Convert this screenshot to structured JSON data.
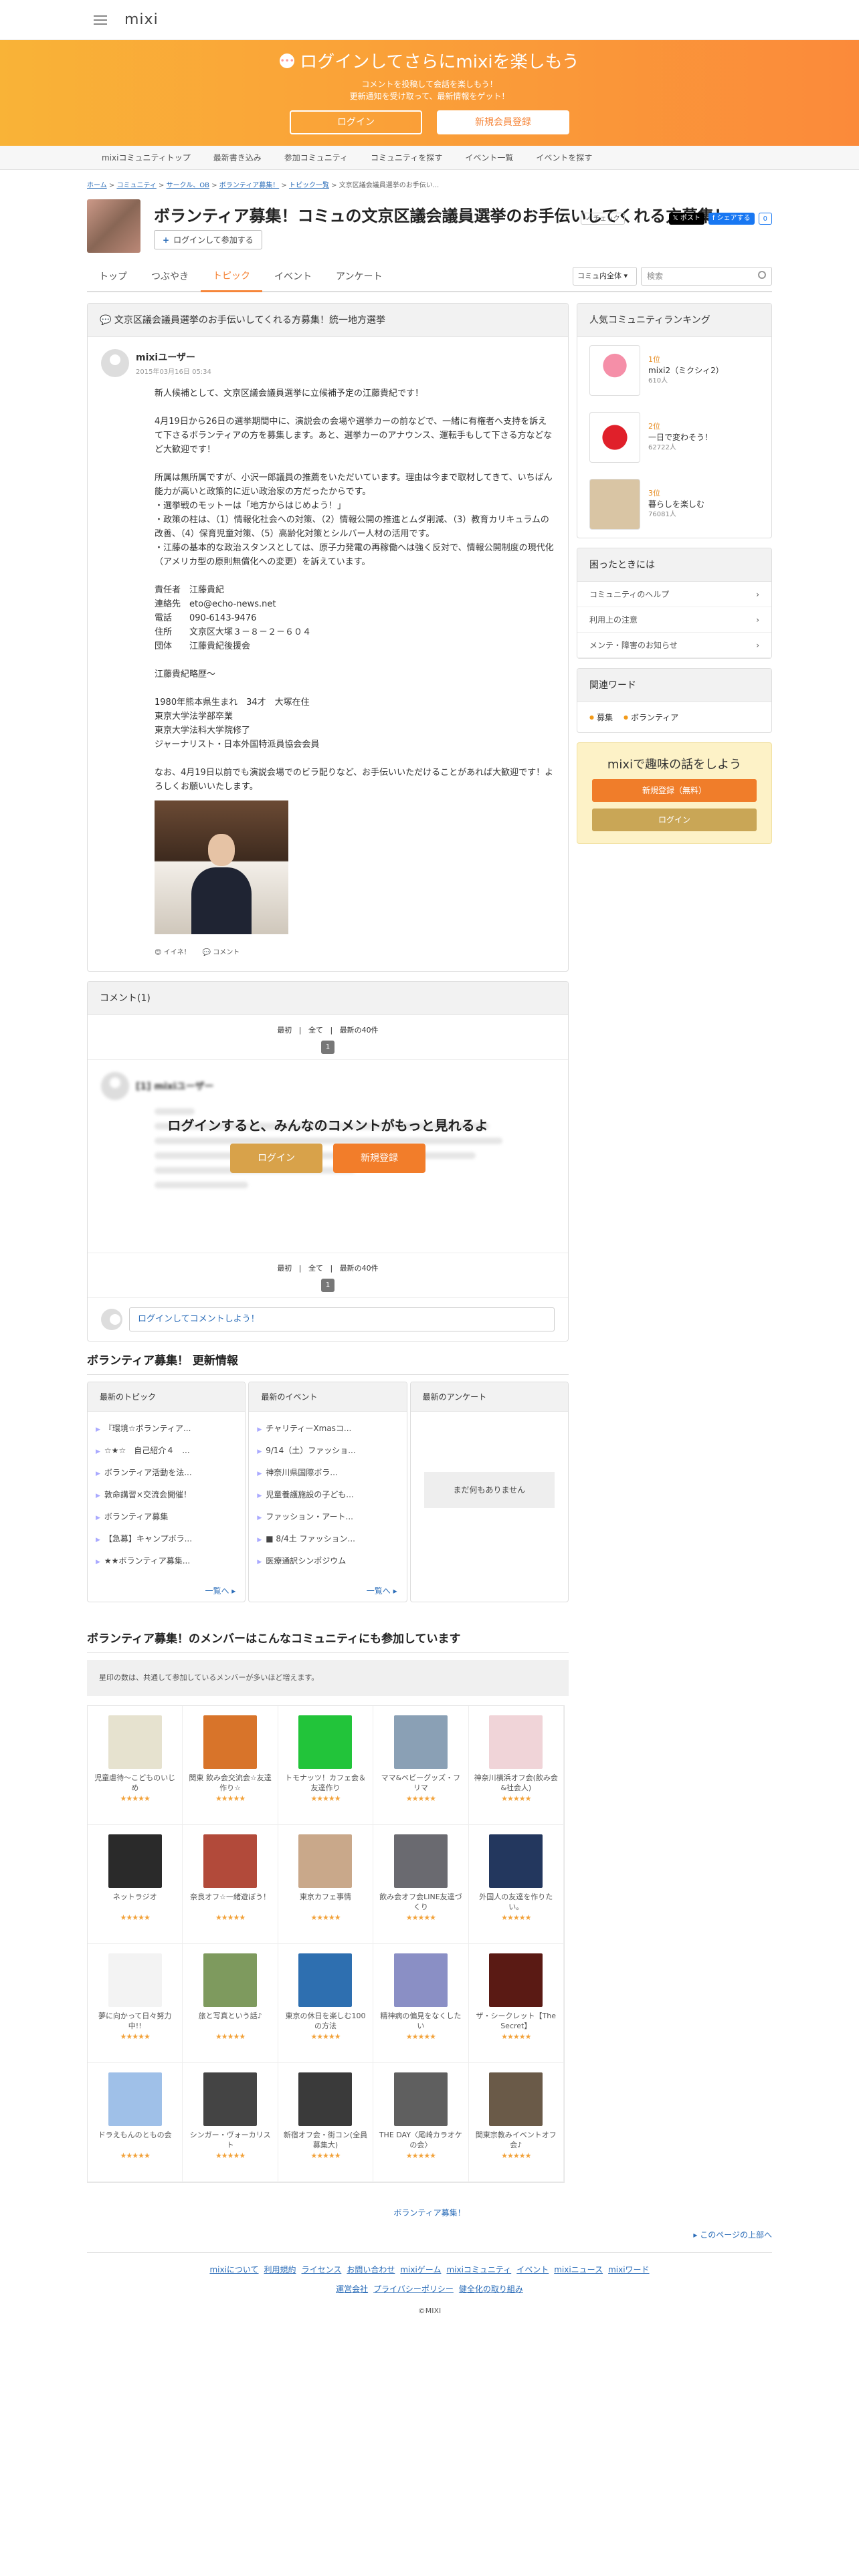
{
  "header": {
    "logo": "mixi"
  },
  "banner": {
    "title": "ログインしてさらにmixiを楽しもう",
    "line1": "コメントを投稿して会話を楽しもう！",
    "line2": "更新通知を受け取って、最新情報をゲット！",
    "login": "ログイン",
    "register": "新規会員登録"
  },
  "gnav": [
    "mixiコミュニティトップ",
    "最新書き込み",
    "参加コミュニティ",
    "コミュニティを探す",
    "イベント一覧",
    "イベントを探す"
  ],
  "breadcrumb": [
    "ホーム",
    "コミュニティ",
    "サークル、OB",
    "ボランティア募集！",
    "トピック一覧",
    "文京区議会議員選挙のお手伝い..."
  ],
  "community": {
    "title": "ボランティア募集！コミュの文京区議会議員選挙のお手伝いしてくれる方募集！...",
    "join": "ログインして参加する",
    "check": "チェック",
    "post": "ポスト",
    "share": "シェアする",
    "share_count": "0"
  },
  "tabs": [
    "トップ",
    "つぶやき",
    "トピック",
    "イベント",
    "アンケート"
  ],
  "search": {
    "scope": "コミュ内全体",
    "placeholder": "検索"
  },
  "topic": {
    "heading": "文京区議会議員選挙のお手伝いしてくれる方募集！統一地方選挙",
    "author": "mixiユーザー",
    "date": "2015年03月16日 05:34",
    "lines": [
      "新人候補として、文京区議会議員選挙に立候補予定の江藤貴紀です！",
      "",
      "4月19日から26日の選挙期間中に、演説会の会場や選挙カーの前などで、一緒に有権者へ支持を訴えて下さるボランティアの方を募集します。あと、選挙カーのアナウンス、運転手もして下さる方などなど大歓迎です！",
      "",
      "所属は無所属ですが、小沢一郎議員の推薦をいただいています。理由は今まで取材してきて、いちばん能力が高いと政策的に近い政治家の方だったからです。",
      "・選挙戦のモットーは「地方からはじめよう！」",
      "・政策の柱は、（1）情報化社会への対策、（2）情報公開の推進とムダ削減、（3）教育カリキュラムの改善、（4）保育児童対策、（5）高齢化対策とシルバー人材の活用です。",
      "・江藤の基本的な政治スタンスとしては、原子力発電の再稼働へは強く反対で、情報公開制度の現代化（アメリカ型の原則無償化への変更）を訴えています。",
      "",
      "責任者　江藤貴紀",
      "連絡先　eto@echo-news.net",
      "電話　　090-6143-9476",
      "住所　　文京区大塚３－８－２－６０４",
      "団体　　江藤貴紀後援会",
      "",
      "江藤貴紀略歴～",
      "",
      "1980年熊本県生まれ　34才　大塚在住",
      "東京大学法学部卒業",
      "東京大学法科大学院修了",
      "ジャーナリスト・日本外国特派員協会会員",
      "",
      "なお、4月19日以前でも演説会場でのビラ配りなど、お手伝いいただけることがあれば大歓迎です！よろしくお願いいたします。"
    ],
    "like": "イイネ！",
    "comment": "コメント"
  },
  "comments": {
    "heading": "コメント(1)",
    "pager": [
      "最初",
      "全て",
      "最新の40件"
    ],
    "page": "1",
    "blur_user": "[1] mixiユーザー",
    "overlay_title": "ログインすると、みんなのコメントがもっと見れるよ",
    "login": "ログイン",
    "register": "新規登録",
    "input": "ログインしてコメントしよう！"
  },
  "updates": {
    "title": "ボランティア募集！ 更新情報",
    "topics_head": "最新のトピック",
    "topics": [
      "『環境☆ボランティア...",
      "☆★☆　自己紹介４　...",
      "ボランティア活動を法...",
      "敦命講習×交流会開催！",
      "ボランティア募集",
      "【急募】キャンプボラ...",
      "★★ボランティア募集..."
    ],
    "events_head": "最新のイベント",
    "events": [
      "チャリティーXmasコ...",
      "9/14（土）ファッショ...",
      "神奈川県国際ボラ...",
      "児童養護施設の子ども...",
      "ファッション・アート...",
      "■ 8/4土 ファッション...",
      "医療通訳シンポジウム"
    ],
    "enq_head": "最新のアンケート",
    "enq_empty": "まだ何もありません",
    "more": "一覧へ"
  },
  "related": {
    "title": "ボランティア募集！のメンバーはこんなコミュニティにも参加しています",
    "note": "星印の数は、共通して参加しているメンバーが多いほど増えます。",
    "stars": "★★★★★",
    "items": [
      {
        "name": "児童虐待～こどものいじめ",
        "color": "#e6e2cf"
      },
      {
        "name": "関東 飲み会交流会☆友達作り☆",
        "color": "#d8742a"
      },
      {
        "name": "トモナッツ！カフェ会＆友達作り",
        "color": "#22c43a"
      },
      {
        "name": "ママ&ベビーグッズ・フリマ",
        "color": "#8aa0b5"
      },
      {
        "name": "神奈川横浜オフ会(飲み会&社会人)",
        "color": "#f0d4d8"
      },
      {
        "name": "ネットラジオ",
        "color": "#2a2a2a"
      },
      {
        "name": "奈良オフ☆一緒遊ぼう！",
        "color": "#b24a3a"
      },
      {
        "name": "東京カフェ事情",
        "color": "#c9a88a"
      },
      {
        "name": "飲み会オフ会LINE友達づくり",
        "color": "#6a6a70"
      },
      {
        "name": "外国人の友達を作りたい。",
        "color": "#23375e"
      },
      {
        "name": "夢に向かって日々努力中!!",
        "color": "#f3f3f3"
      },
      {
        "name": "旅と写真という話♪",
        "color": "#7e9a5e"
      },
      {
        "name": "東京の休日を楽しむ100の方法",
        "color": "#2e6fb0"
      },
      {
        "name": "精神病の偏見をなくしたい",
        "color": "#8a8fc5"
      },
      {
        "name": "ザ・シークレット【The Secret】",
        "color": "#5a1a14"
      },
      {
        "name": "ドラえもんのともの会",
        "color": "#9fc0e8"
      },
      {
        "name": "シンガー・ヴォーカリスト",
        "color": "#444444"
      },
      {
        "name": "新宿オフ会・街コン(全員募集大)",
        "color": "#3a3a3a"
      },
      {
        "name": "THE DAY〈尾崎カラオケの会〉",
        "color": "#5f5f5f"
      },
      {
        "name": "関東宗教みイベントオフ会♪",
        "color": "#6a5a48"
      }
    ]
  },
  "footer": {
    "community_link": "ボランティア募集！",
    "to_top": "このページの上部へ",
    "links1": [
      "mixiについて",
      "利用規約",
      "ライセンス",
      "お問い合わせ",
      "mixiゲーム",
      "mixiコミュニティ",
      "イベント",
      "mixiニュース",
      "mixiワード"
    ],
    "links2": [
      "運営会社",
      "プライバシーポリシー",
      "健全化の取り組み"
    ],
    "copyright": "©MIXI"
  },
  "sidebar": {
    "ranking_title": "人気コミュニティランキング",
    "ranking": [
      {
        "rank": "1位",
        "name": "mixi2（ミクシィ2）",
        "count": "610人"
      },
      {
        "rank": "2位",
        "name": "一日で変わそう！",
        "count": "62722人"
      },
      {
        "rank": "3位",
        "name": "暮らしを楽しむ",
        "count": "76081人"
      }
    ],
    "help_title": "困ったときには",
    "help": [
      "コミュニティのヘルプ",
      "利用上の注意",
      "メンテ・障害のお知らせ"
    ],
    "kw_title": "関連ワード",
    "keywords": [
      "募集",
      "ボランティア"
    ],
    "cta_title": "mixiで趣味の話をしよう",
    "cta_register": "新規登録（無料）",
    "cta_login": "ログイン"
  },
  "colors": {
    "accent": "#f6863a",
    "link": "#2a6cb8"
  }
}
